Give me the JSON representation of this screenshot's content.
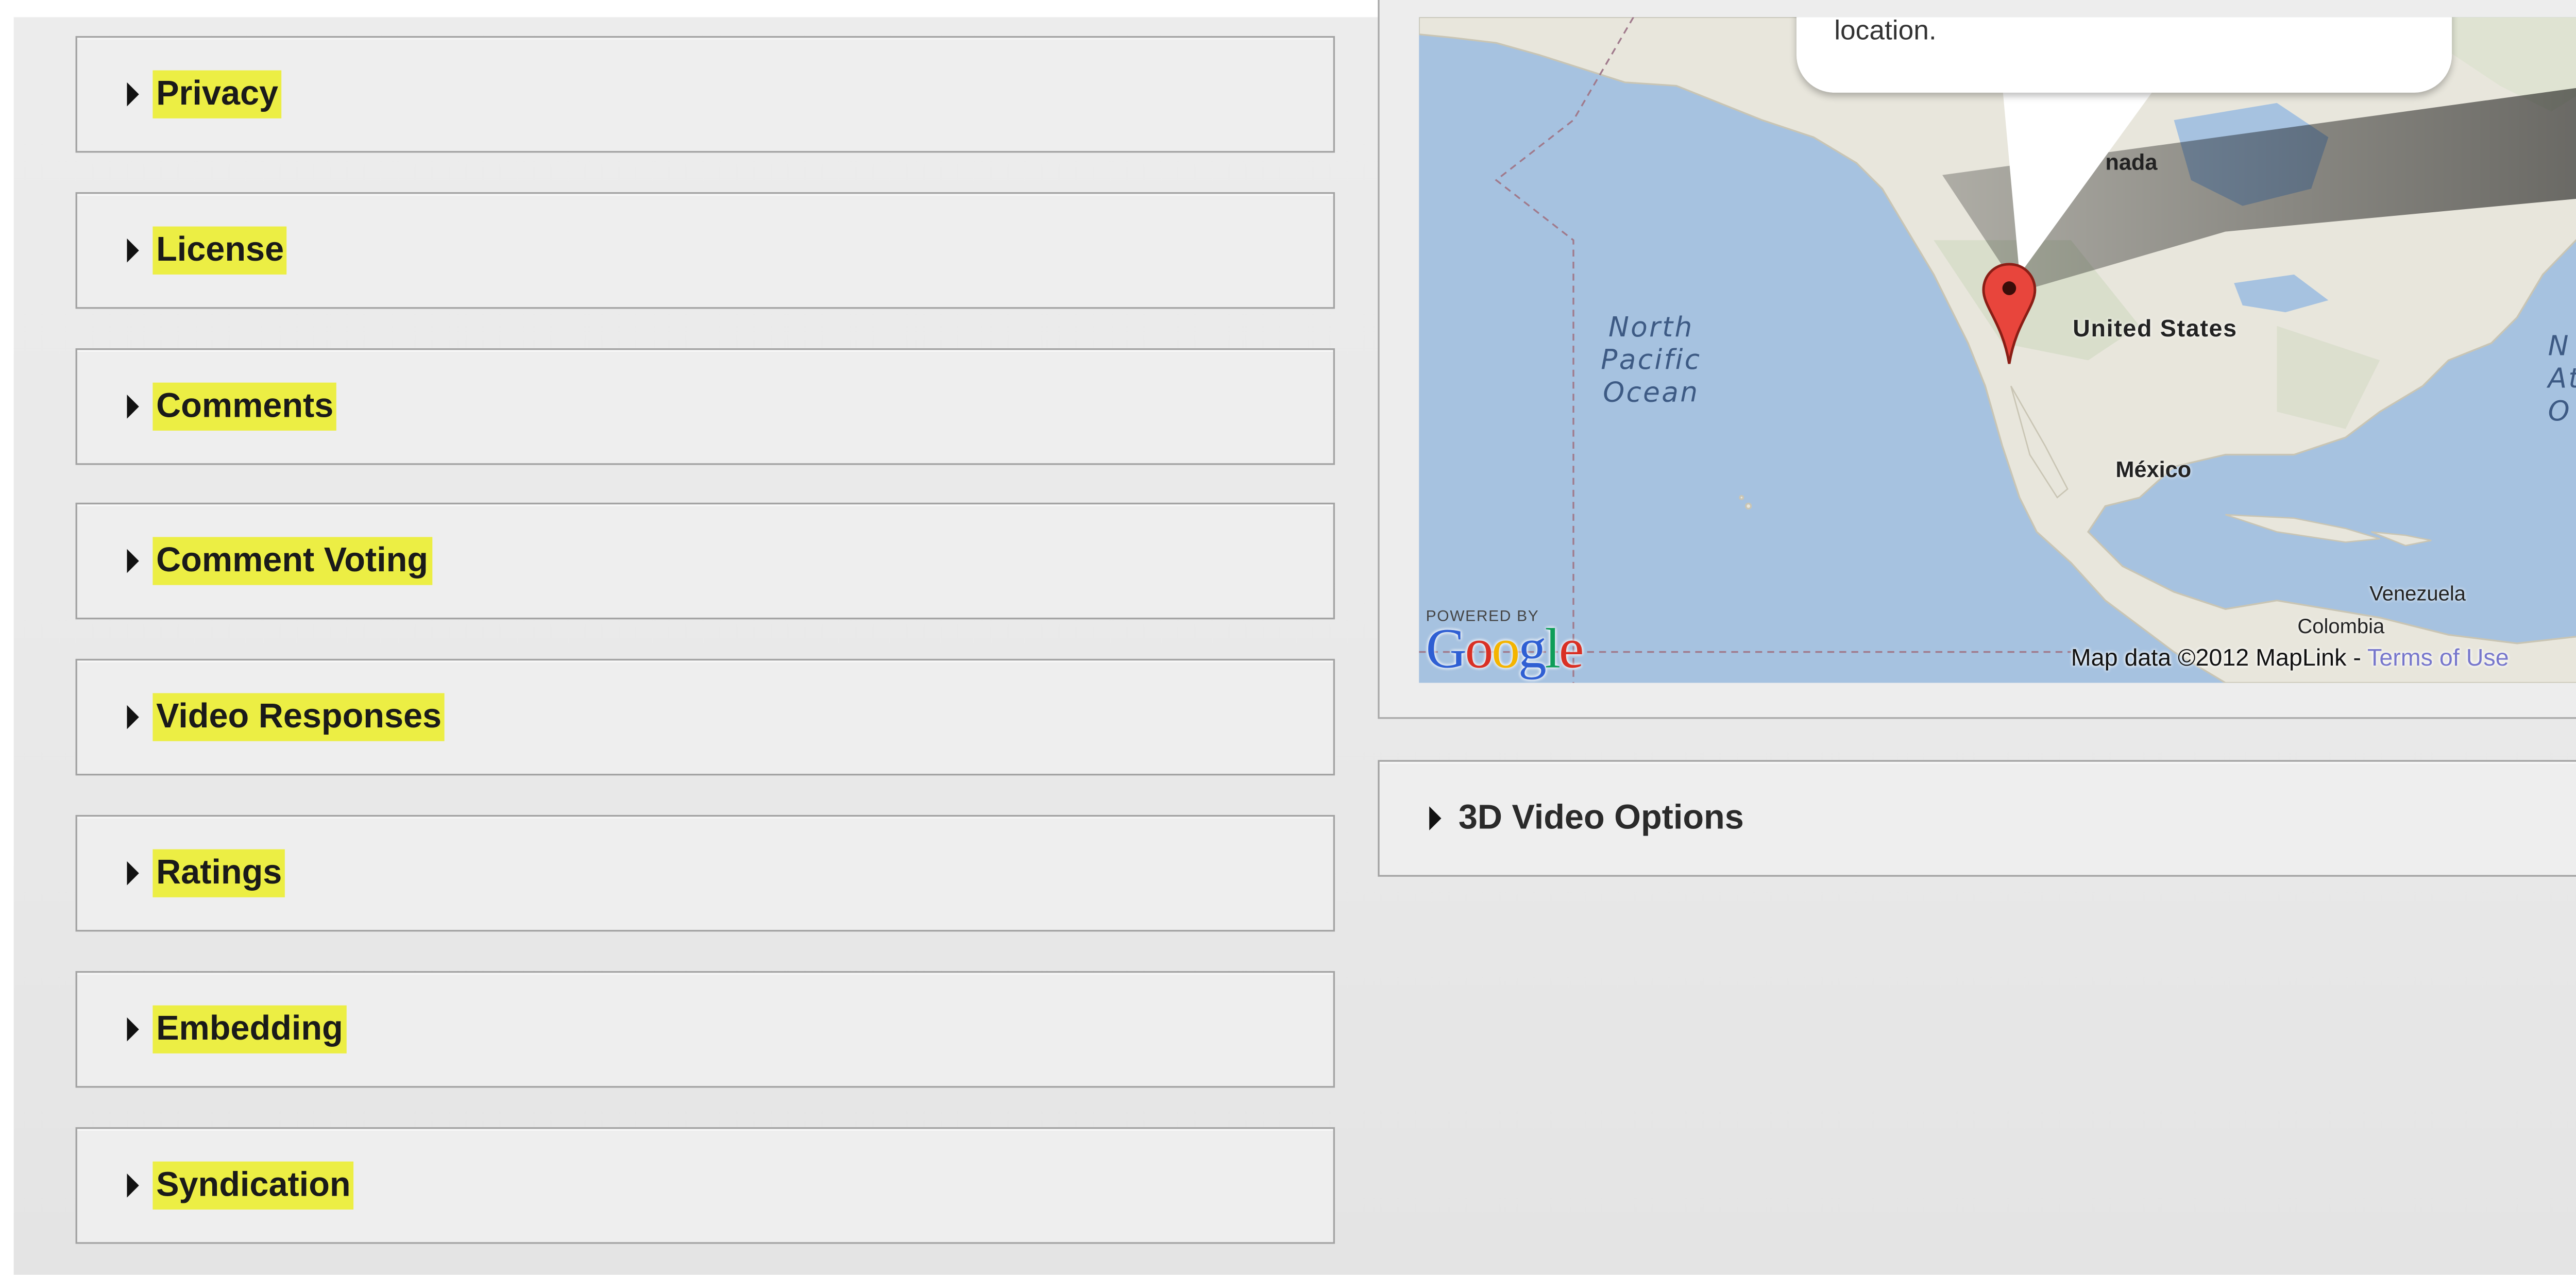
{
  "sections_left": [
    {
      "label": "Privacy"
    },
    {
      "label": "License"
    },
    {
      "label": "Comments"
    },
    {
      "label": "Comment Voting"
    },
    {
      "label": "Video Responses"
    },
    {
      "label": "Ratings"
    },
    {
      "label": "Embedding"
    },
    {
      "label": "Syndication"
    }
  ],
  "sections_right": [
    {
      "label": "3D Video Options"
    }
  ],
  "map": {
    "bubble_text": "location.",
    "country_labels": {
      "canada": "nada",
      "united_states": "United States",
      "mexico": "México",
      "venezuela": "Venezuela",
      "colombia": "Colombia"
    },
    "ocean_labels": {
      "north_pacific": "North\nPacific\nOcean",
      "north_atlantic_partial": "N\nAt\nO"
    },
    "powered_by": "POWERED BY",
    "google_logo": [
      "G",
      "o",
      "o",
      "g",
      "l",
      "e"
    ],
    "attribution": "Map data ©2012 MapLink - ",
    "terms_link": "Terms of Use",
    "marker_icon": "map-pin-icon"
  },
  "colors": {
    "highlight": "#ecee44",
    "ocean": "#a6c2e0",
    "land": "#e8e6dc",
    "marker": "#e8453c",
    "google": [
      "#2f5fd3",
      "#d93025",
      "#f4b400",
      "#2f5fd3",
      "#0f9d58",
      "#d93025"
    ]
  }
}
